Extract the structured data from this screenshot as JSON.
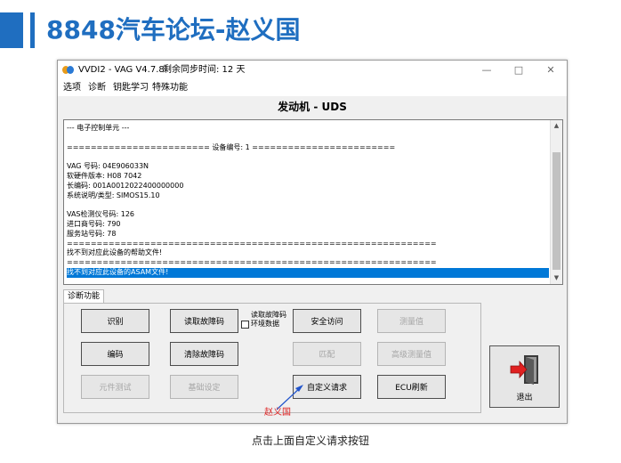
{
  "slide": {
    "title": "8848汽车论坛-赵义国",
    "caption": "点击上面自定义请求按钮",
    "accent_color": "#1f6ec0"
  },
  "window": {
    "title": "VVDI2 - VAG V4.7.8",
    "sync_text": "剩余同步时间: 12 天",
    "icon": "vvdi-app-icon",
    "controls": [
      "minimize-icon",
      "maximize-icon",
      "close-icon"
    ]
  },
  "menu": [
    "选项",
    "诊断",
    "钥匙学习",
    "特殊功能"
  ],
  "panel_title": "发动机 - UDS",
  "log": {
    "lines": [
      " --- 电子控制单元 ---",
      "",
      "======================== 设备编号: 1 ========================",
      "",
      "VAG 号码: 04E906033N",
      "软硬件版本: H08 7042",
      "长编码: 001A0012022400000000",
      "系统说明/类型: SIMOS15.10",
      "",
      "VAS检测仪号码: 126",
      "进口商号码: 790",
      "服务站号码: 78",
      "==============================================================",
      "找不到对应此设备的帮助文件!",
      "==============================================================",
      "找不到对应此设备的ASAM文件!"
    ],
    "selected_line": "找不到对应此设备的ASAM文件!"
  },
  "diag_tab": "诊断功能",
  "buttons": {
    "identify": "识别",
    "read_dtc": "读取故障码",
    "security_access": "安全访问",
    "measure": "测量值",
    "coding": "编码",
    "clear_dtc": "清除故障码",
    "adaptation": "匹配",
    "adv_measure": "高级测量值",
    "component_test": "元件测试",
    "basic_setting": "基础设定",
    "custom_request": "自定义请求",
    "ecu_flash": "ECU刷新",
    "exit": "退出"
  },
  "checkbox_label": "读取故障码环境数据",
  "annotation": {
    "text": "赵义国",
    "color": "#dd2222"
  }
}
